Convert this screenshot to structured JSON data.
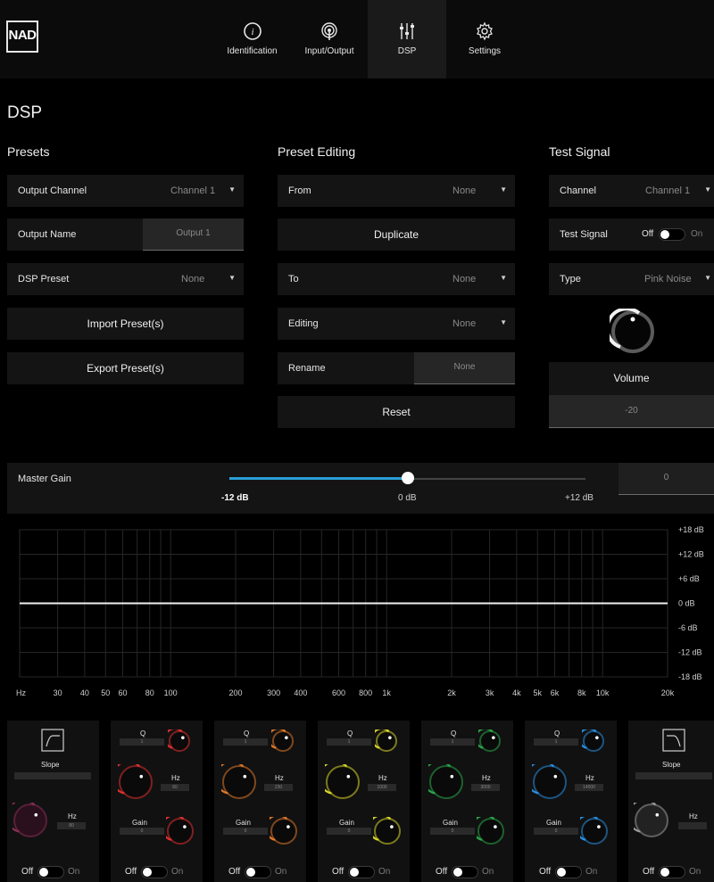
{
  "nav": {
    "logo": "NAD",
    "tabs": [
      {
        "label": "Identification",
        "icon": "info-icon"
      },
      {
        "label": "Input/Output",
        "icon": "broadcast-icon"
      },
      {
        "label": "DSP",
        "icon": "sliders-icon"
      },
      {
        "label": "Settings",
        "icon": "gear-icon"
      }
    ],
    "active_tab": "DSP"
  },
  "page_title": "DSP",
  "presets": {
    "title": "Presets",
    "output_channel": {
      "label": "Output Channel",
      "value": "Channel 1"
    },
    "output_name": {
      "label": "Output Name",
      "value": "Output 1"
    },
    "dsp_preset": {
      "label": "DSP Preset",
      "value": "None"
    },
    "import_label": "Import Preset(s)",
    "export_label": "Export Preset(s)"
  },
  "preset_editing": {
    "title": "Preset Editing",
    "from": {
      "label": "From",
      "value": "None"
    },
    "duplicate_label": "Duplicate",
    "to": {
      "label": "To",
      "value": "None"
    },
    "editing": {
      "label": "Editing",
      "value": "None"
    },
    "rename": {
      "label": "Rename",
      "value": "None"
    },
    "reset_label": "Reset"
  },
  "test_signal": {
    "title": "Test Signal",
    "channel": {
      "label": "Channel",
      "value": "Channel 1"
    },
    "test_signal": {
      "label": "Test Signal",
      "off": "Off",
      "on": "On"
    },
    "type": {
      "label": "Type",
      "value": "Pink Noise"
    },
    "volume_label": "Volume",
    "volume_value": "-20"
  },
  "master_gain": {
    "label": "Master Gain",
    "min_label": "-12 dB",
    "mid_label": "0 dB",
    "max_label": "+12 dB",
    "value": "0",
    "slider_fraction": 0.5
  },
  "eq_graph": {
    "db_labels": [
      "+18 dB",
      "+12 dB",
      "+6 dB",
      "0 dB",
      "-6 dB",
      "-12 dB",
      "-18 dB"
    ],
    "hz_unit": "Hz",
    "freq_labels": [
      "30",
      "40",
      "50",
      "60",
      "80",
      "100",
      "200",
      "300",
      "400",
      "600",
      "800",
      "1k",
      "2k",
      "3k",
      "4k",
      "5k",
      "6k",
      "8k",
      "10k",
      "20k"
    ]
  },
  "bands": [
    {
      "kind": "hp",
      "slope_label": "Slope",
      "hz_label": "Hz",
      "hz_value": "80",
      "color": "#8a2f55",
      "off": "Off",
      "on": "On"
    },
    {
      "kind": "peq",
      "q_label": "Q",
      "q_value": "1",
      "hz_label": "Hz",
      "hz_value": "60",
      "gain_label": "Gain",
      "gain_value": "0",
      "color": "#e03030",
      "off": "Off",
      "on": "On"
    },
    {
      "kind": "peq",
      "q_label": "Q",
      "q_value": "1",
      "hz_label": "Hz",
      "hz_value": "230",
      "gain_label": "Gain",
      "gain_value": "0",
      "color": "#e0782a",
      "off": "Off",
      "on": "On"
    },
    {
      "kind": "peq",
      "q_label": "Q",
      "q_value": "1",
      "hz_label": "Hz",
      "hz_value": "1000",
      "gain_label": "Gain",
      "gain_value": "0",
      "color": "#d9d62a",
      "off": "Off",
      "on": "On"
    },
    {
      "kind": "peq",
      "q_label": "Q",
      "q_value": "1",
      "hz_label": "Hz",
      "hz_value": "3000",
      "gain_label": "Gain",
      "gain_value": "0",
      "color": "#2aa84a",
      "off": "Off",
      "on": "On"
    },
    {
      "kind": "peq",
      "q_label": "Q",
      "q_value": "1",
      "hz_label": "Hz",
      "hz_value": "14000",
      "gain_label": "Gain",
      "gain_value": "0",
      "color": "#2a8fe0",
      "off": "Off",
      "on": "On"
    },
    {
      "kind": "lp",
      "slope_label": "Slope",
      "hz_label": "Hz",
      "hz_value": "",
      "color": "#9a9a9a",
      "off": "Off",
      "on": "On"
    }
  ],
  "colors": {
    "accent": "#2a9fd6",
    "panel": "#141414",
    "field": "#262626"
  }
}
